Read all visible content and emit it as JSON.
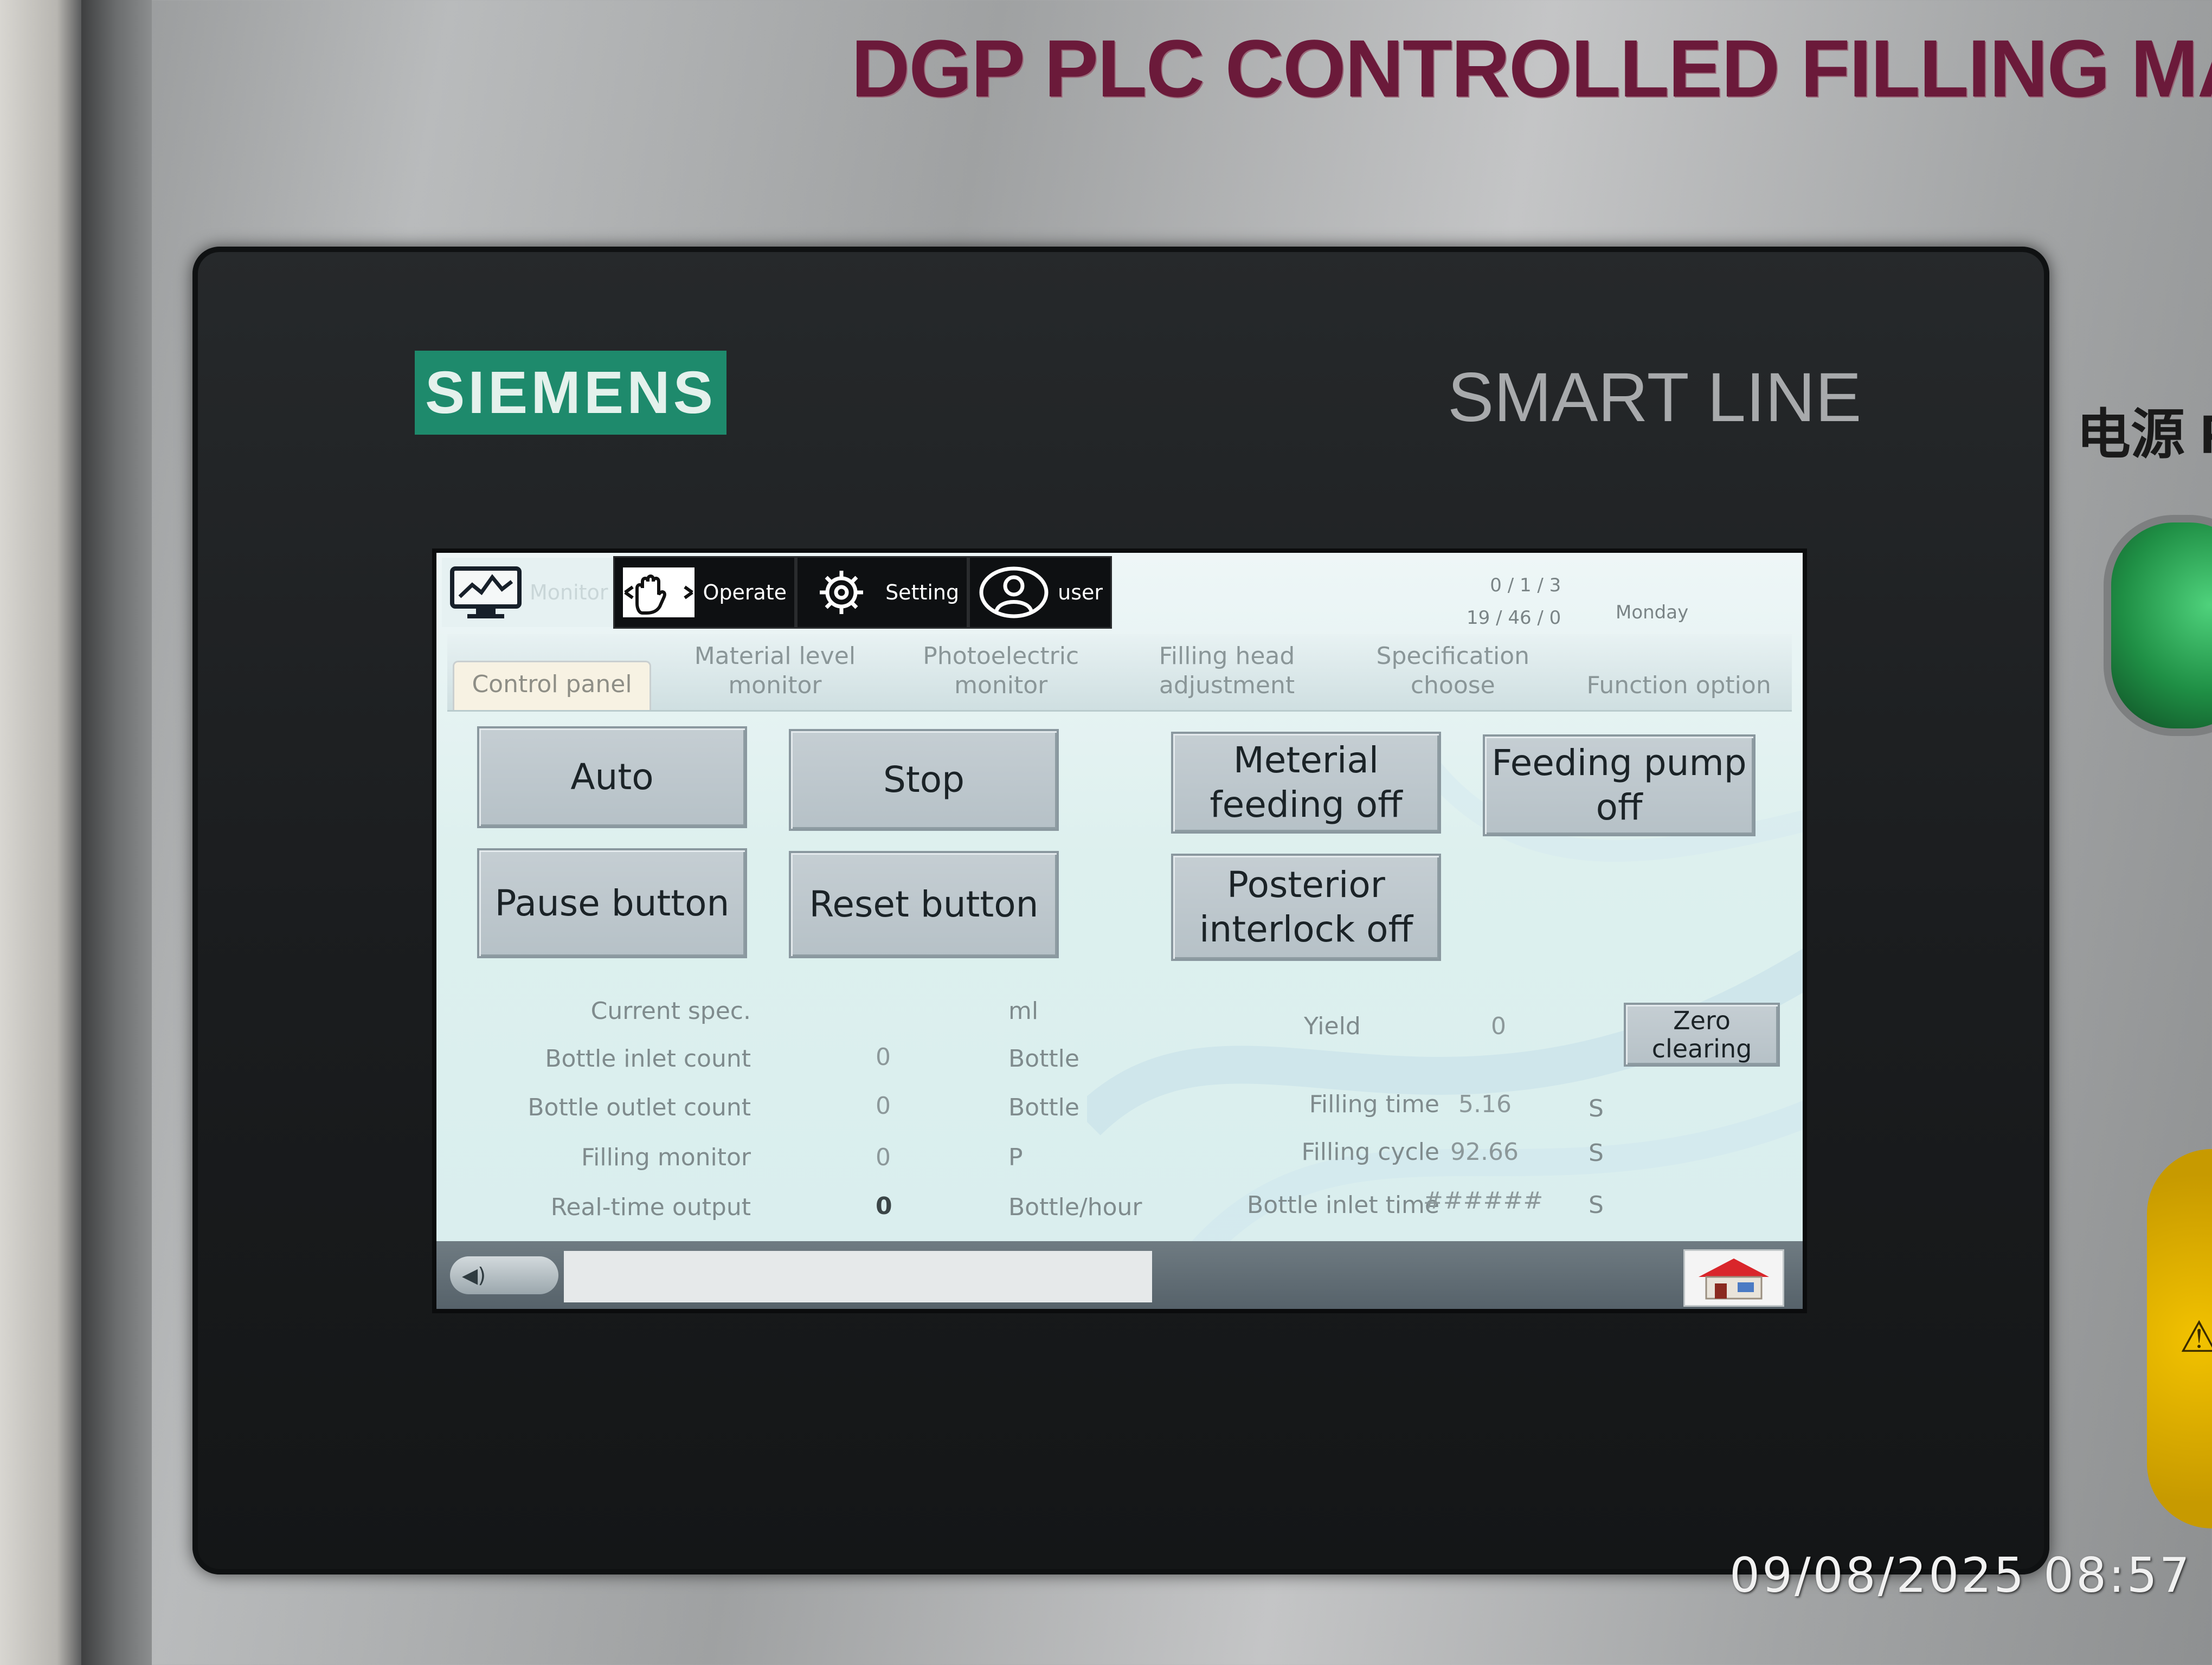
{
  "machine": {
    "header": "DGP PLC CONTROLLED FILLING MACHINE",
    "power_label": "电源 POWER",
    "brand": "SIEMENS",
    "model_line": "SMART LINE"
  },
  "nav": {
    "monitor": "Monitor",
    "operate": "Operate",
    "setting": "Setting",
    "user": "user"
  },
  "status": {
    "date_line": "0 / 1 / 3",
    "time_line": "19 / 46 / 0",
    "weekday": "Monday"
  },
  "tabs": {
    "control_panel": "Control panel",
    "material_level_monitor": "Material level monitor",
    "photoelectric_monitor": "Photoelectric monitor",
    "filling_head_adjustment": "Filling head adjustment",
    "specification_choose": "Specification choose",
    "function_option": "Function option"
  },
  "buttons": {
    "auto": "Auto",
    "stop": "Stop",
    "meterial_feeding_off": "Meterial feeding off",
    "feeding_pump_off": "Feeding pump off",
    "pause_button": "Pause button",
    "reset_button": "Reset button",
    "posterior_interlock_off": "Posterior interlock off",
    "zero_clearing": "Zero clearing"
  },
  "stats": {
    "current_spec": {
      "label": "Current spec.",
      "value": "",
      "unit": "ml"
    },
    "bottle_inlet_count": {
      "label": "Bottle inlet count",
      "value": "0",
      "unit": "Bottle"
    },
    "bottle_outlet_count": {
      "label": "Bottle outlet count",
      "value": "0",
      "unit": "Bottle"
    },
    "filling_monitor": {
      "label": "Filling monitor",
      "value": "0",
      "unit": "P"
    },
    "realtime_output": {
      "label": "Real-time output",
      "value": "0",
      "unit": "Bottle/hour"
    },
    "yield": {
      "label": "Yield",
      "value": "0"
    },
    "filling_time": {
      "label": "Filling time",
      "value": "5.16",
      "unit": "S"
    },
    "filling_cycle": {
      "label": "Filling cycle",
      "value": "92.66",
      "unit": "S"
    },
    "bottle_inlet_time": {
      "label": "Bottle inlet time",
      "value": "######",
      "unit": "S"
    }
  },
  "photo_timestamp": "09/08/2025 08:57"
}
